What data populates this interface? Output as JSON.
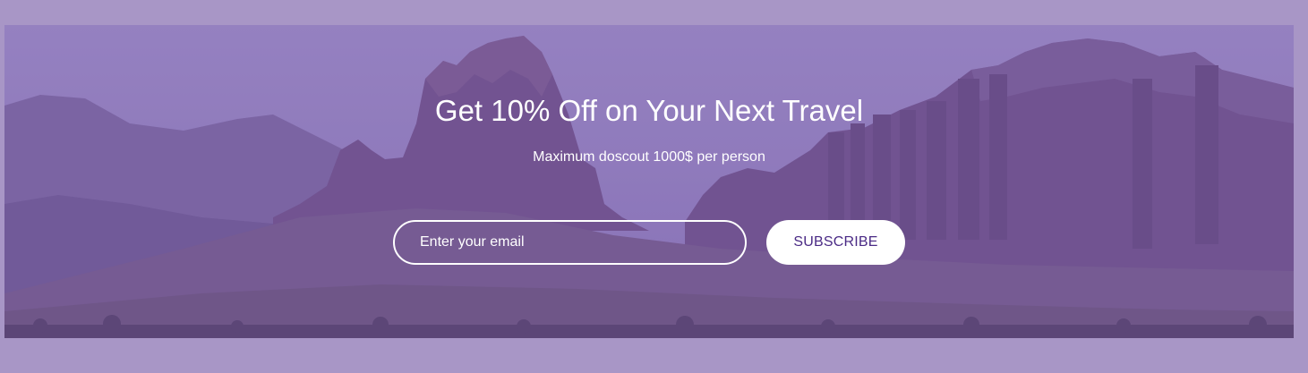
{
  "promo": {
    "headline": "Get 10% Off on Your Next Travel",
    "subtitle": "Maximum doscout 1000$ per person",
    "email_placeholder": "Enter your email",
    "email_value": "",
    "subscribe_label": "SUBSCRIBE"
  },
  "colors": {
    "page_background": "#a896c6",
    "overlay": "#7d5faf",
    "button_background": "#ffffff",
    "button_text": "#4a2a85",
    "text": "#ffffff"
  },
  "icons": {
    "background_image": "mountain-landscape-image"
  }
}
